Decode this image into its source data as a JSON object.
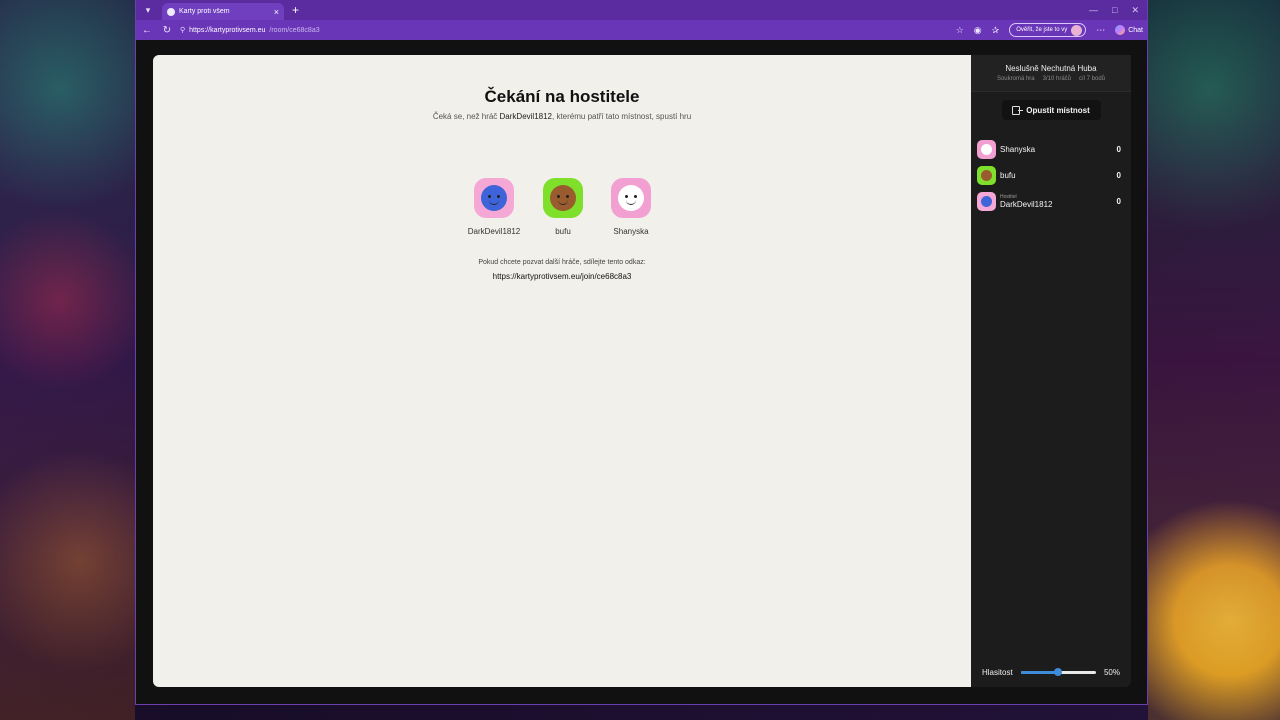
{
  "browser": {
    "tab_title": "Karty proti všem",
    "url_host": "https://kartyprotivsem.eu",
    "url_path": "/room/ce68c8a3",
    "verify_label": "Ověřit, že jste to vy",
    "chat_label": "Chat"
  },
  "page": {
    "heading": "Čekání na hostitele",
    "sub_before": "Čeká se, než hráč ",
    "sub_host": "DarkDevil1812",
    "sub_after": ", kterému patří tato místnost, spustí hru",
    "invite_text": "Pokud chcete pozvat další hráče, sdílejte tento odkaz:",
    "invite_link": "https://kartyprotivsem.eu/join/ce68c8a3",
    "players": [
      {
        "name": "DarkDevil1812",
        "bg": "#f5a8d6",
        "face": "#3f63d8"
      },
      {
        "name": "bufu",
        "bg": "#7ee02a",
        "face": "#9a5b2e"
      },
      {
        "name": "Shanyska",
        "bg": "#f2a0d2",
        "face": "#ffffff"
      }
    ]
  },
  "sidebar": {
    "room_name": "Neslušně Nechutná Huba",
    "room_type": "Soukromá hra",
    "room_players": "3/10 hráčů",
    "room_goal": "cíl 7 bodů",
    "leave_label": "Opustit místnost",
    "players": [
      {
        "name": "Shanyska",
        "role": "",
        "score": "0",
        "bg": "#f2a0d2",
        "face": "#ffffff"
      },
      {
        "name": "bufu",
        "role": "",
        "score": "0",
        "bg": "#7ee02a",
        "face": "#9a5b2e"
      },
      {
        "name": "DarkDevil1812",
        "role": "Hostitel",
        "score": "0",
        "bg": "#f5a8d6",
        "face": "#3f63d8"
      }
    ],
    "volume_label": "Hlasitost",
    "volume_value": "50%",
    "volume_fraction": 0.5
  }
}
